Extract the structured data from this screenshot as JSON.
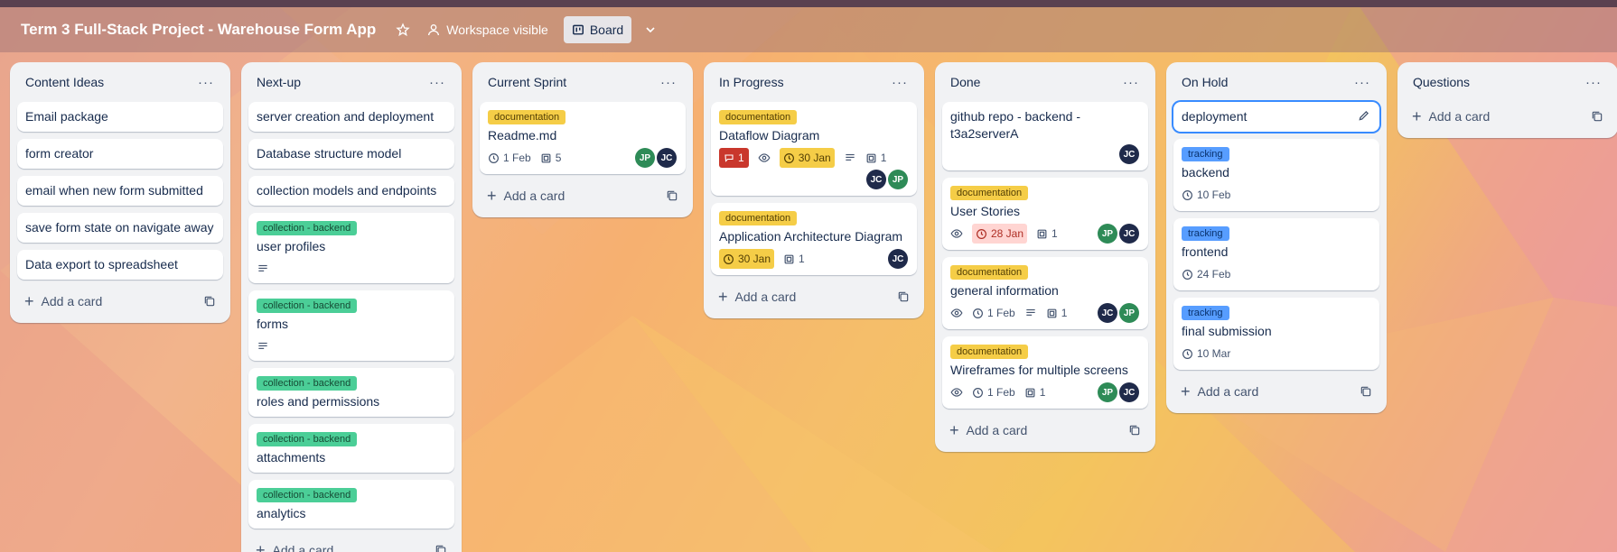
{
  "board": {
    "title": "Term 3 Full-Stack Project - Warehouse Form App",
    "visibility_label": "Workspace visible",
    "view_label": "Board"
  },
  "lists": [
    {
      "title": "Content Ideas",
      "cards": [
        {
          "title": "Email package"
        },
        {
          "title": "form creator"
        },
        {
          "title": "email when new form submitted"
        },
        {
          "title": "save form state on navigate away"
        },
        {
          "title": "Data export to spreadsheet"
        }
      ],
      "add_label": "Add a card"
    },
    {
      "title": "Next-up",
      "cards": [
        {
          "title": "server creation and deployment"
        },
        {
          "title": "Database structure model"
        },
        {
          "title": "collection models and endpoints"
        },
        {
          "label": "collection - backend",
          "title": "user profiles"
        },
        {
          "label": "collection - backend",
          "title": "forms"
        },
        {
          "label": "collection - backend",
          "title": "roles and permissions"
        },
        {
          "label": "collection - backend",
          "title": "attachments"
        },
        {
          "label": "collection - backend",
          "title": "analytics"
        }
      ],
      "add_label": "Add a card"
    },
    {
      "title": "Current Sprint",
      "cards": [
        {
          "label": "documentation",
          "title": "Readme.md",
          "due": "1 Feb",
          "attachments": "5",
          "members": [
            "JP",
            "JC"
          ]
        }
      ],
      "add_label": "Add a card"
    },
    {
      "title": "In Progress",
      "cards": [
        {
          "label": "documentation",
          "title": "Dataflow Diagram",
          "comments": "1",
          "due": "30 Jan",
          "attachments": "1",
          "members": [
            "JC",
            "JP"
          ]
        },
        {
          "label": "documentation",
          "title": "Application Architecture Diagram",
          "due": "30 Jan",
          "attachments": "1",
          "members": [
            "JC"
          ]
        }
      ],
      "add_label": "Add a card"
    },
    {
      "title": "Done",
      "cards": [
        {
          "title": "github repo - backend - t3a2serverA",
          "members": [
            "JC"
          ]
        },
        {
          "label": "documentation",
          "title": "User Stories",
          "due": "28 Jan",
          "attachments": "1",
          "members": [
            "JP",
            "JC"
          ]
        },
        {
          "label": "documentation",
          "title": "general information",
          "due": "1 Feb",
          "attachments": "1",
          "members": [
            "JC",
            "JP"
          ]
        },
        {
          "label": "documentation",
          "title": "Wireframes for multiple screens",
          "due": "1 Feb",
          "attachments": "1",
          "members": [
            "JP",
            "JC"
          ]
        }
      ],
      "add_label": "Add a card"
    },
    {
      "title": "On Hold",
      "cards": [
        {
          "title": "deployment"
        },
        {
          "label": "tracking",
          "title": "backend",
          "due": "10 Feb"
        },
        {
          "label": "tracking",
          "title": "frontend",
          "due": "24 Feb"
        },
        {
          "label": "tracking",
          "title": "final submission",
          "due": "10 Mar"
        }
      ],
      "add_label": "Add a card"
    },
    {
      "title": "Questions",
      "cards": [],
      "add_label": "Add a card"
    }
  ],
  "colors": {
    "label_documentation": "#f5cd47",
    "label_collection": "#4bce97",
    "label_tracking": "#579dff",
    "due_overdue": "#ffd5d2",
    "comment_badge": "#c9372c",
    "avatar_jc": "#1f2a4a",
    "avatar_jp": "#2e8b57"
  }
}
